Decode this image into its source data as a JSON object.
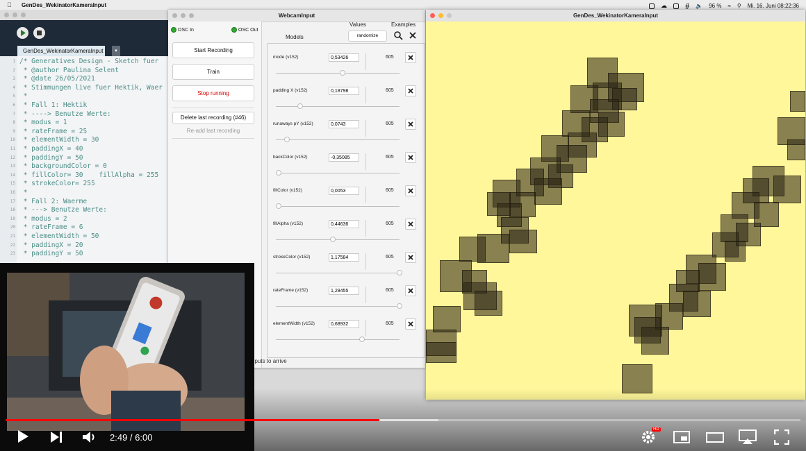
{
  "menubar": {
    "app_name": "GenDes_WekinatorKameraInput",
    "battery": "96 %",
    "clock": "Mi. 16. Juni 08:22:36"
  },
  "processing": {
    "tab_label": "GenDes_WekinatorKameraInput",
    "line_numbers": [
      "1",
      "2",
      "3",
      "4",
      "5",
      "6",
      "7",
      "8",
      "9",
      "10",
      "11",
      "12",
      "13",
      "14",
      "15",
      "16",
      "17",
      "18",
      "19",
      "20",
      "21",
      "22",
      "23"
    ],
    "code_lines": [
      "/* Generatives Design - Sketch fuer",
      " * @author Paulina Selent",
      " * @date 26/05/2021",
      " * Stimmungen live fuer Hektik, Waer",
      " *",
      " * Fall 1: Hektik",
      " * ----> Benutze Werte:",
      " * modus = 1",
      " * rateFrame = 25",
      " * elementWidth = 30",
      " * paddingX = 40",
      " * paddingY = 50",
      " * backgroundColor = 0",
      " * fillColor= 30    fillAlpha = 255",
      " * strokeColor= 255",
      " *",
      " * Fall 2: Waerme",
      " * ---> Benutze Werte:",
      " * modus = 2",
      " * rateFrame = 6",
      " * elementWidth = 50",
      " * paddingX = 20",
      " * paddingY = 50"
    ]
  },
  "wekinator": {
    "title": "WebcamInput",
    "osc_in": "OSC In",
    "osc_out": "OSC Out",
    "start_recording": "Start Recording",
    "train": "Train",
    "stop_running": "Stop running",
    "delete_last": "Delete last recording (#46)",
    "readd_last": "Re-add last recording",
    "models_header": "Models",
    "values_header": "Values",
    "examples_header": "Examples",
    "randomize": "randomize",
    "status": "nputs to arrive",
    "params": [
      {
        "name": "mode (v152)",
        "value": "0,53426",
        "count": "605",
        "slider": 0.53
      },
      {
        "name": "padding X (v152)",
        "value": "0,18798",
        "count": "605",
        "slider": 0.18
      },
      {
        "name": "runaways pY (v152)",
        "value": "0,0743",
        "count": "605",
        "slider": 0.07
      },
      {
        "name": "backColor (v152)",
        "value": "-0,35085",
        "count": "605",
        "slider": 0.0
      },
      {
        "name": "fillColor (v152)",
        "value": "0,0053",
        "count": "605",
        "slider": 0.0
      },
      {
        "name": "fillAlpha (v152)",
        "value": "0,44636",
        "count": "605",
        "slider": 0.45
      },
      {
        "name": "strokeColor (v152)",
        "value": "1,17584",
        "count": "605",
        "slider": 1.0
      },
      {
        "name": "rateFrame (v152)",
        "value": "1,28455",
        "count": "605",
        "slider": 1.0
      },
      {
        "name": "elementWidth (v152)",
        "value": "0,68932",
        "count": "605",
        "slider": 0.69
      }
    ]
  },
  "output": {
    "title": "GenDes_WekinatorKameraInput",
    "bg_color": "#fff799"
  },
  "player": {
    "time": "2:49 / 6:00",
    "progress": 0.47,
    "buffered": 0.545,
    "hd_badge": "HD",
    "icons": [
      "play-icon",
      "next-icon",
      "volume-icon",
      "settings-icon",
      "miniplayer-icon",
      "theater-icon",
      "airplay-icon",
      "fullscreen-icon"
    ]
  }
}
